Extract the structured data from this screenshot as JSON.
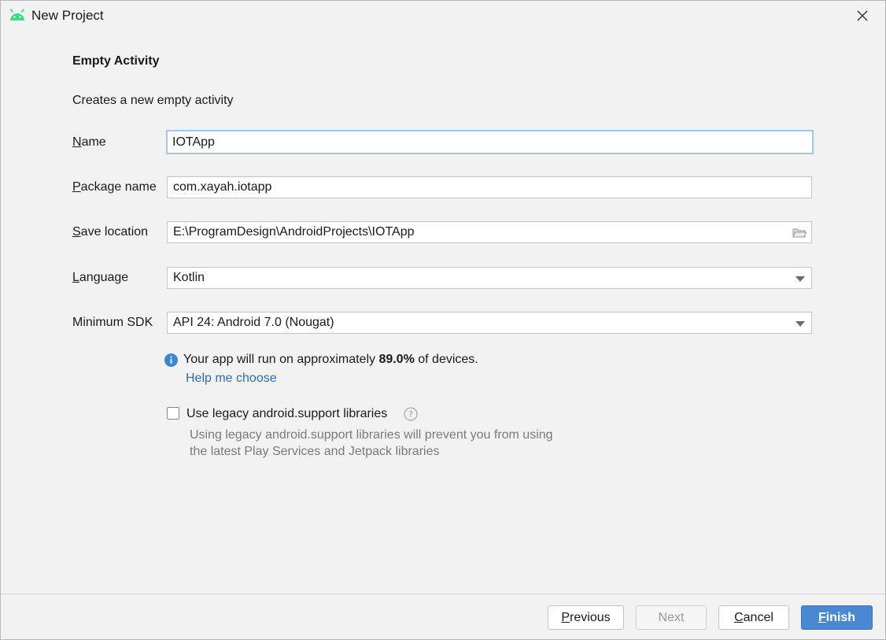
{
  "window": {
    "title": "New Project"
  },
  "form": {
    "heading": "Empty Activity",
    "subheading": "Creates a new empty activity",
    "name": {
      "label_mnemonic": "N",
      "label_rest": "ame",
      "value": "IOTApp"
    },
    "package": {
      "label_mnemonic": "P",
      "label_rest": "ackage name",
      "value": "com.xayah.iotapp"
    },
    "save_location": {
      "label_mnemonic": "S",
      "label_rest": "ave location",
      "value": "E:\\ProgramDesign\\AndroidProjects\\IOTApp"
    },
    "language": {
      "label_mnemonic": "L",
      "label_rest": "anguage",
      "value": "Kotlin"
    },
    "min_sdk": {
      "label": "Minimum SDK",
      "value": "API 24: Android 7.0 (Nougat)"
    },
    "info": {
      "prefix": "Your app will run on approximately ",
      "percent": "89.0%",
      "suffix": " of devices.",
      "help_link": "Help me choose"
    },
    "legacy": {
      "checked": false,
      "label": "Use legacy android.support libraries",
      "hint_line1": "Using legacy android.support libraries will prevent you from using",
      "hint_line2": "the latest Play Services and Jetpack libraries"
    }
  },
  "buttons": {
    "previous": {
      "mnemonic": "P",
      "rest": "revious"
    },
    "next": {
      "label": "Next"
    },
    "cancel": {
      "mnemonic": "C",
      "rest": "ancel"
    },
    "finish": {
      "mnemonic": "F",
      "rest": "inish"
    }
  },
  "colors": {
    "android_green": "#3ddc84",
    "info_blue": "#3a87d6",
    "link_blue": "#2f6db3",
    "primary_button": "#4a88d4"
  },
  "icons": {
    "app": "android-icon",
    "close": "close-icon",
    "folder": "folder-icon",
    "dropdown": "chevron-down-icon",
    "info": "info-icon",
    "help": "question-icon"
  }
}
